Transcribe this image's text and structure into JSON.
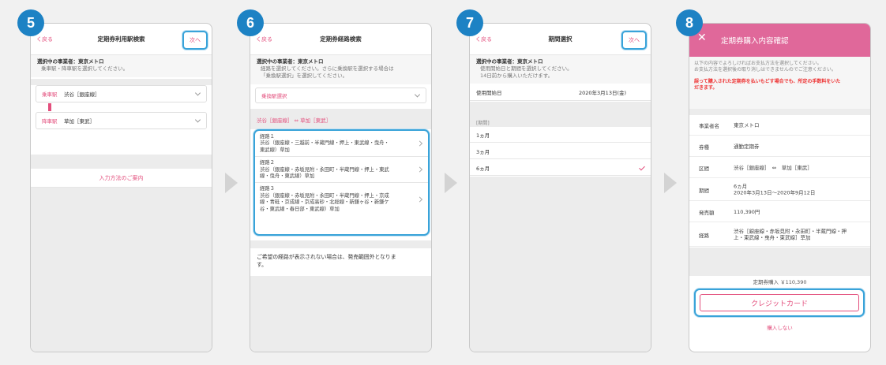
{
  "steps": [
    "5",
    "6",
    "7",
    "8"
  ],
  "screen1": {
    "back": "く戻る",
    "title": "定期券利用駅検索",
    "next": "次へ",
    "operator": "選択中の事業者：東京メトロ",
    "message": "乗車駅・降車駅を選択してください。",
    "board_label": "乗車駅",
    "board_value": "渋谷［銀座線］",
    "alight_label": "降車駅",
    "alight_value": "草加［東武］",
    "guide_link": "入力方法のご案内"
  },
  "screen2": {
    "back": "く戻る",
    "title": "定期券経路検索",
    "operator": "選択中の事業者：東京メトロ",
    "message1": "経路を選択してください。さらに乗換駅を選択する場合は",
    "message2": "「乗換駅選択」を選択してください。",
    "transfer_select": "乗換駅選択",
    "od": "渋谷［銀座線］ ⇔ 草加［東武］",
    "routes": [
      {
        "name": "経路１",
        "line1": "渋谷（銀座線・三越前・半蔵門線・押上・東武線・曳舟・",
        "line2": "東武線）草加",
        "line3": ""
      },
      {
        "name": "経路２",
        "line1": "渋谷（銀座線・赤坂見附・永田町・半蔵門線・押上・東武",
        "line2": "線・曳舟・東武線）草加",
        "line3": ""
      },
      {
        "name": "経路３",
        "line1": "渋谷（銀座線・赤坂見附・永田町・半蔵門線・押上・京成",
        "line2": "線・青砥・京成線・京成高砂・北総線・新鎌ヶ谷・新鎌ケ",
        "line3": "谷・東武線・春日部・東武線）草加"
      }
    ],
    "note": "ご希望の経路が表示されない場合は、発売範囲外となりま",
    "note2": "す。"
  },
  "screen3": {
    "back": "く戻る",
    "title": "期間選択",
    "next": "次へ",
    "operator": "選択中の事業者：東京メトロ",
    "message1": "使用開始日と期間を選択してください。",
    "message2": "14日前から購入いただけます。",
    "start_label": "使用開始日",
    "start_value": "2020年3月13日(金)",
    "period_header": "[期間]",
    "periods": [
      "1ヵ月",
      "3ヵ月",
      "6ヵ月"
    ]
  },
  "screen4": {
    "title": "定期券購入内容確認",
    "intro1": "以下の内容でよろしければお支払方法を選択してください。",
    "intro2": "お支払方法を選択後の取り消しはできませんのでご注意ください。",
    "warn1": "誤って購入された定期券を払いもどす場合でも、所定の手数料をいた",
    "warn2": "だきます。",
    "rows": [
      {
        "key": "事業者名",
        "value": "東京メトロ",
        "value2": ""
      },
      {
        "key": "券種",
        "value": "通勤定期券",
        "value2": ""
      },
      {
        "key": "区間",
        "value": "渋谷［銀座線］　⇔　草加［東武］",
        "value2": ""
      },
      {
        "key": "期間",
        "value": "6ヵ月",
        "value2": "2020年3月13日〜2020年9月12日"
      },
      {
        "key": "発売額",
        "value": "110,390円",
        "value2": ""
      },
      {
        "key": "経路",
        "value": "渋谷［銀座線・赤坂見附・永田町・半蔵門線・押",
        "value2": "上・東武線・曳舟・東武線］草加"
      }
    ],
    "total": "定期券購入 ￥110,390",
    "credit": "クレジットカード",
    "cancel": "購入しない"
  }
}
